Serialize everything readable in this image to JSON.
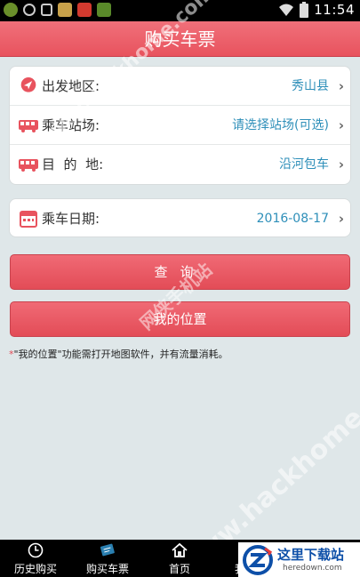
{
  "status_bar": {
    "time": "11:54"
  },
  "header": {
    "title": "购买车票"
  },
  "route_card": {
    "rows": [
      {
        "label": "出发地区:",
        "value": "秀山县"
      },
      {
        "label": "乘车站场:",
        "value": "请选择站场(可选)"
      },
      {
        "label": "目  的  地:",
        "value": "沿河包车"
      }
    ]
  },
  "date_card": {
    "label": "乘车日期:",
    "value": "2016-08-17"
  },
  "buttons": {
    "query": "查询",
    "my_location": "我的位置"
  },
  "note": {
    "star": "*",
    "text": "\"我的位置\"功能需打开地图软件，并有流量消耗。"
  },
  "watermark": {
    "site": "www.hackhome.com",
    "cn": "网侠手机站"
  },
  "bottom_nav": {
    "items": [
      {
        "label": "历史购买"
      },
      {
        "label": "购买车票"
      },
      {
        "label": "首页"
      },
      {
        "label": "我"
      }
    ]
  },
  "corner_badge": {
    "title": "这里下载站",
    "sub": "heredown.com"
  },
  "colors": {
    "accent": "#e8535e",
    "link": "#2e8fb9"
  }
}
